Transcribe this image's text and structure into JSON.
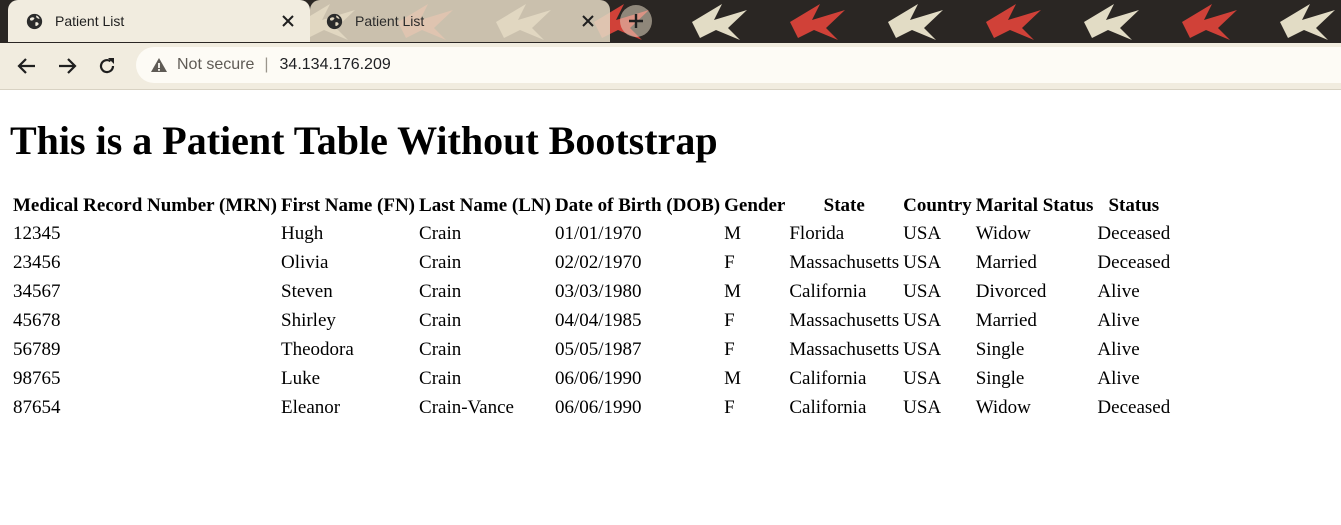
{
  "browser": {
    "tabs": [
      {
        "title": "Patient List",
        "active": true
      },
      {
        "title": "Patient List",
        "active": false
      }
    ],
    "new_tab_label": "+",
    "security_label": "Not secure",
    "url": "34.134.176.209"
  },
  "page": {
    "heading": "This is a Patient Table Without Bootstrap",
    "table": {
      "columns": [
        "Medical Record Number (MRN)",
        "First Name (FN)",
        "Last Name (LN)",
        "Date of Birth (DOB)",
        "Gender",
        "State",
        "Country",
        "Marital Status",
        "Status"
      ],
      "rows": [
        [
          "12345",
          "Hugh",
          "Crain",
          "01/01/1970",
          "M",
          "Florida",
          "USA",
          "Widow",
          "Deceased"
        ],
        [
          "23456",
          "Olivia",
          "Crain",
          "02/02/1970",
          "F",
          "Massachusetts",
          "USA",
          "Married",
          "Deceased"
        ],
        [
          "34567",
          "Steven",
          "Crain",
          "03/03/1980",
          "M",
          "California",
          "USA",
          "Divorced",
          "Alive"
        ],
        [
          "45678",
          "Shirley",
          "Crain",
          "04/04/1985",
          "F",
          "Massachusetts",
          "USA",
          "Married",
          "Alive"
        ],
        [
          "56789",
          "Theodora",
          "Crain",
          "05/05/1987",
          "F",
          "Massachusetts",
          "USA",
          "Single",
          "Alive"
        ],
        [
          "98765",
          "Luke",
          "Crain",
          "06/06/1990",
          "M",
          "California",
          "USA",
          "Single",
          "Alive"
        ],
        [
          "87654",
          "Eleanor",
          "Crain-Vance",
          "06/06/1990",
          "F",
          "California",
          "USA",
          "Widow",
          "Deceased"
        ]
      ]
    }
  },
  "colors": {
    "theme_frame": "#2a2623",
    "theme_toolbar": "#f1ecdf",
    "pattern_red": "#d9423a",
    "pattern_cream": "#ece6cf"
  }
}
